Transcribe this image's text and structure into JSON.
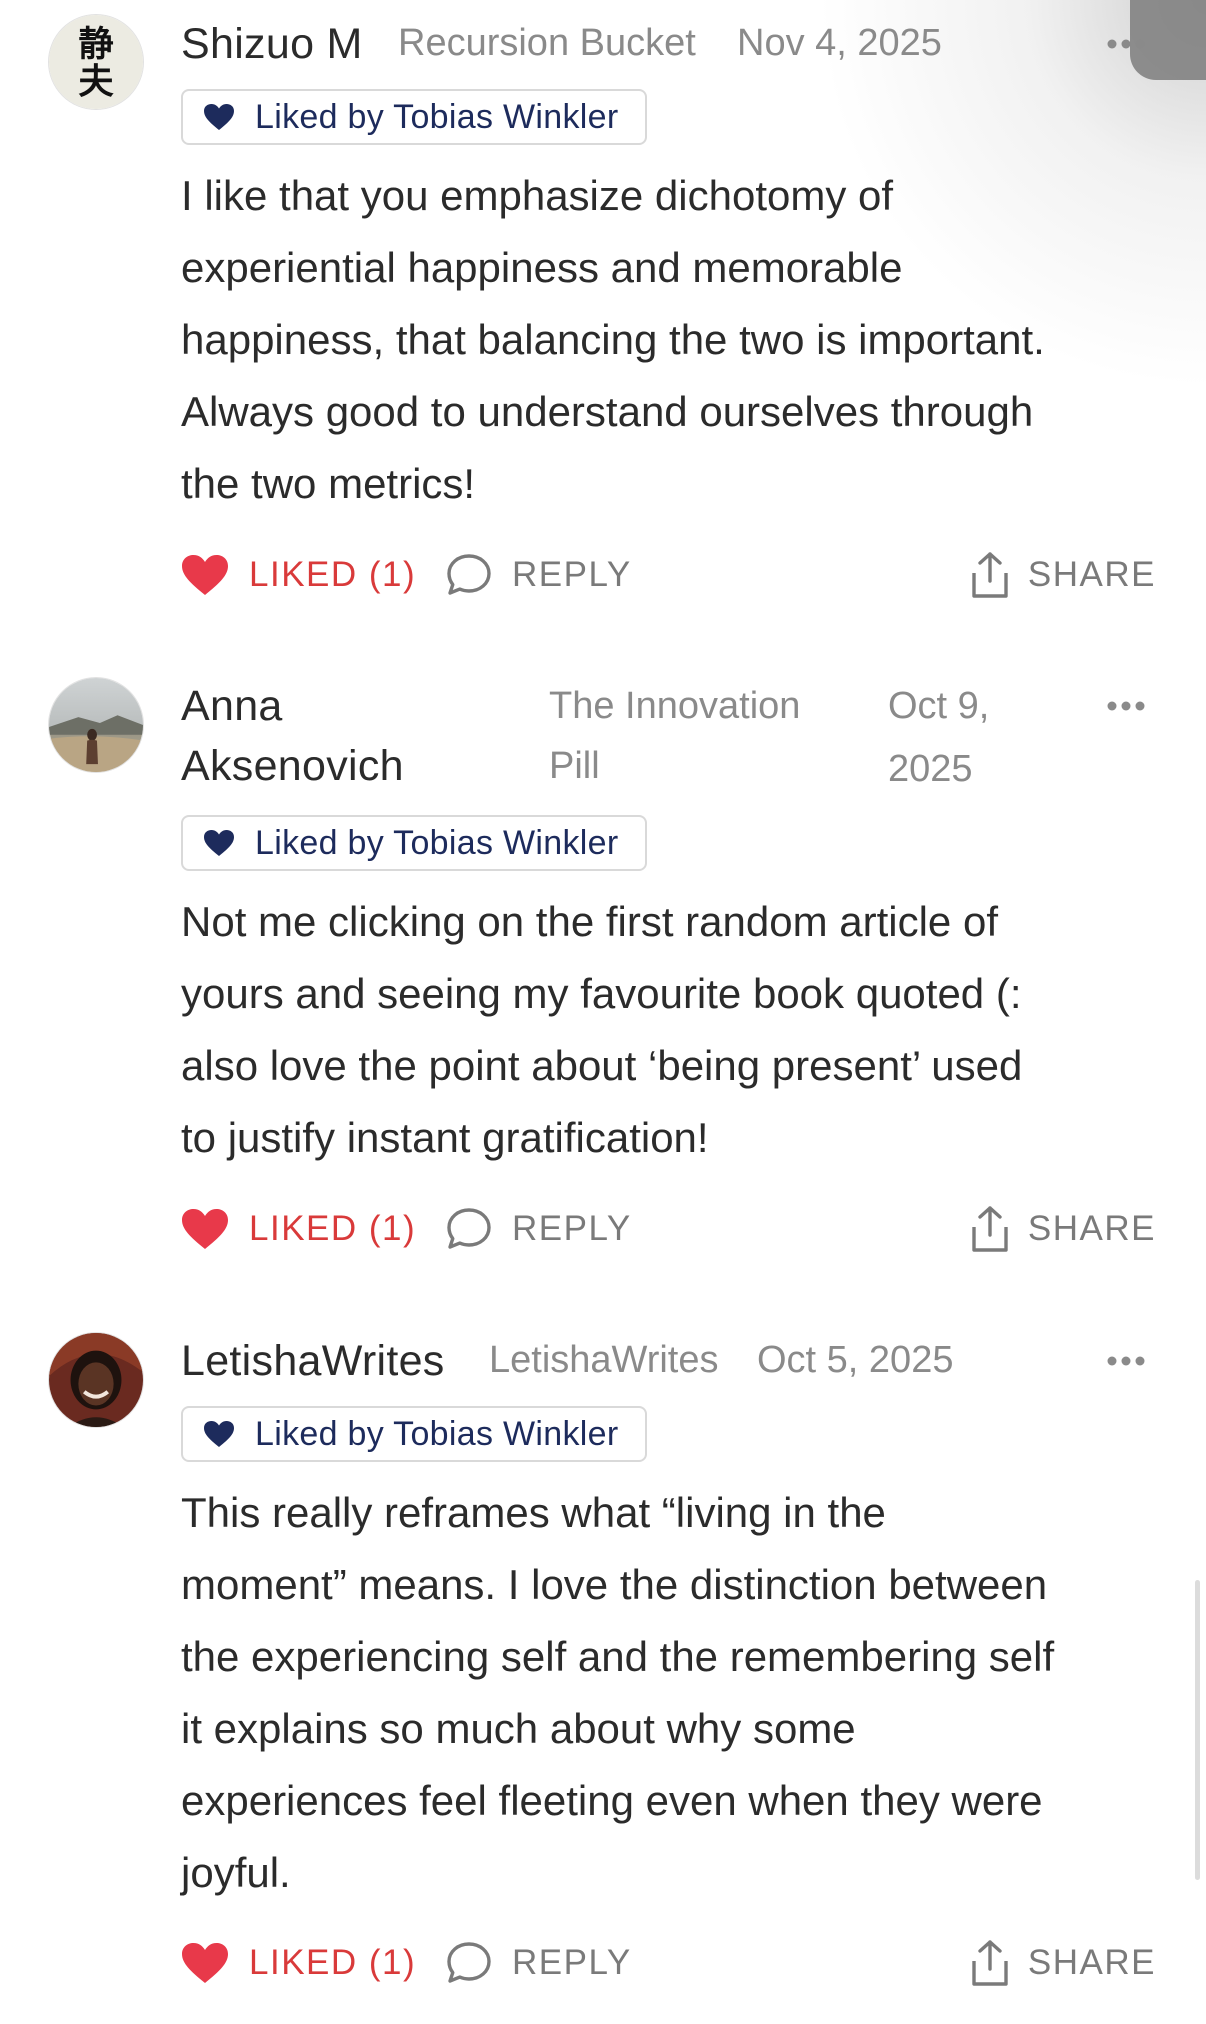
{
  "colors": {
    "liked_red": "#d93a3a",
    "badge_navy": "#1d2b5c",
    "muted_gray": "#8a8a8a",
    "text_dark": "#2b2b2b"
  },
  "comments": [
    {
      "author": "Shizuo M",
      "publication": "Recursion Bucket",
      "date": "Nov 4, 2025",
      "liked_badge": "Liked by Tobias Winkler",
      "text": "I like that you emphasize dichotomy of\nexperiential happiness and memorable\nhappiness, that balancing the two is important.\nAlways good to understand ourselves through\nthe two metrics!",
      "like_label": "LIKED (1)",
      "reply_label": "REPLY",
      "share_label": "SHARE",
      "avatar_glyphs": "静夫",
      "avatar_icon": "calligraphy-avatar"
    },
    {
      "author_line1": "Anna",
      "author_line2": "Aksenovich",
      "publication_line1": "The Innovation",
      "publication_line2": "Pill",
      "date_line1": "Oct 9,",
      "date_line2": "2025",
      "liked_badge": "Liked by Tobias Winkler",
      "text": "Not me clicking on the first random article of\nyours and seeing my favourite book quoted (:\nalso love the point about ‘being present’ used\nto justify instant gratification!",
      "like_label": "LIKED (1)",
      "reply_label": "REPLY",
      "share_label": "SHARE",
      "avatar_icon": "beach-photo-avatar"
    },
    {
      "author": "LetishaWrites",
      "publication": "LetishaWrites",
      "date": "Oct 5, 2025",
      "liked_badge": "Liked by Tobias Winkler",
      "text": "This really reframes what “living in the\nmoment” means. I love the distinction between\nthe experiencing self and the remembering self\nit explains so much about why some\nexperiences feel fleeting even when they were\njoyful.",
      "like_label": "LIKED (1)",
      "reply_label": "REPLY",
      "share_label": "SHARE",
      "avatar_icon": "portrait-photo-avatar"
    }
  ]
}
